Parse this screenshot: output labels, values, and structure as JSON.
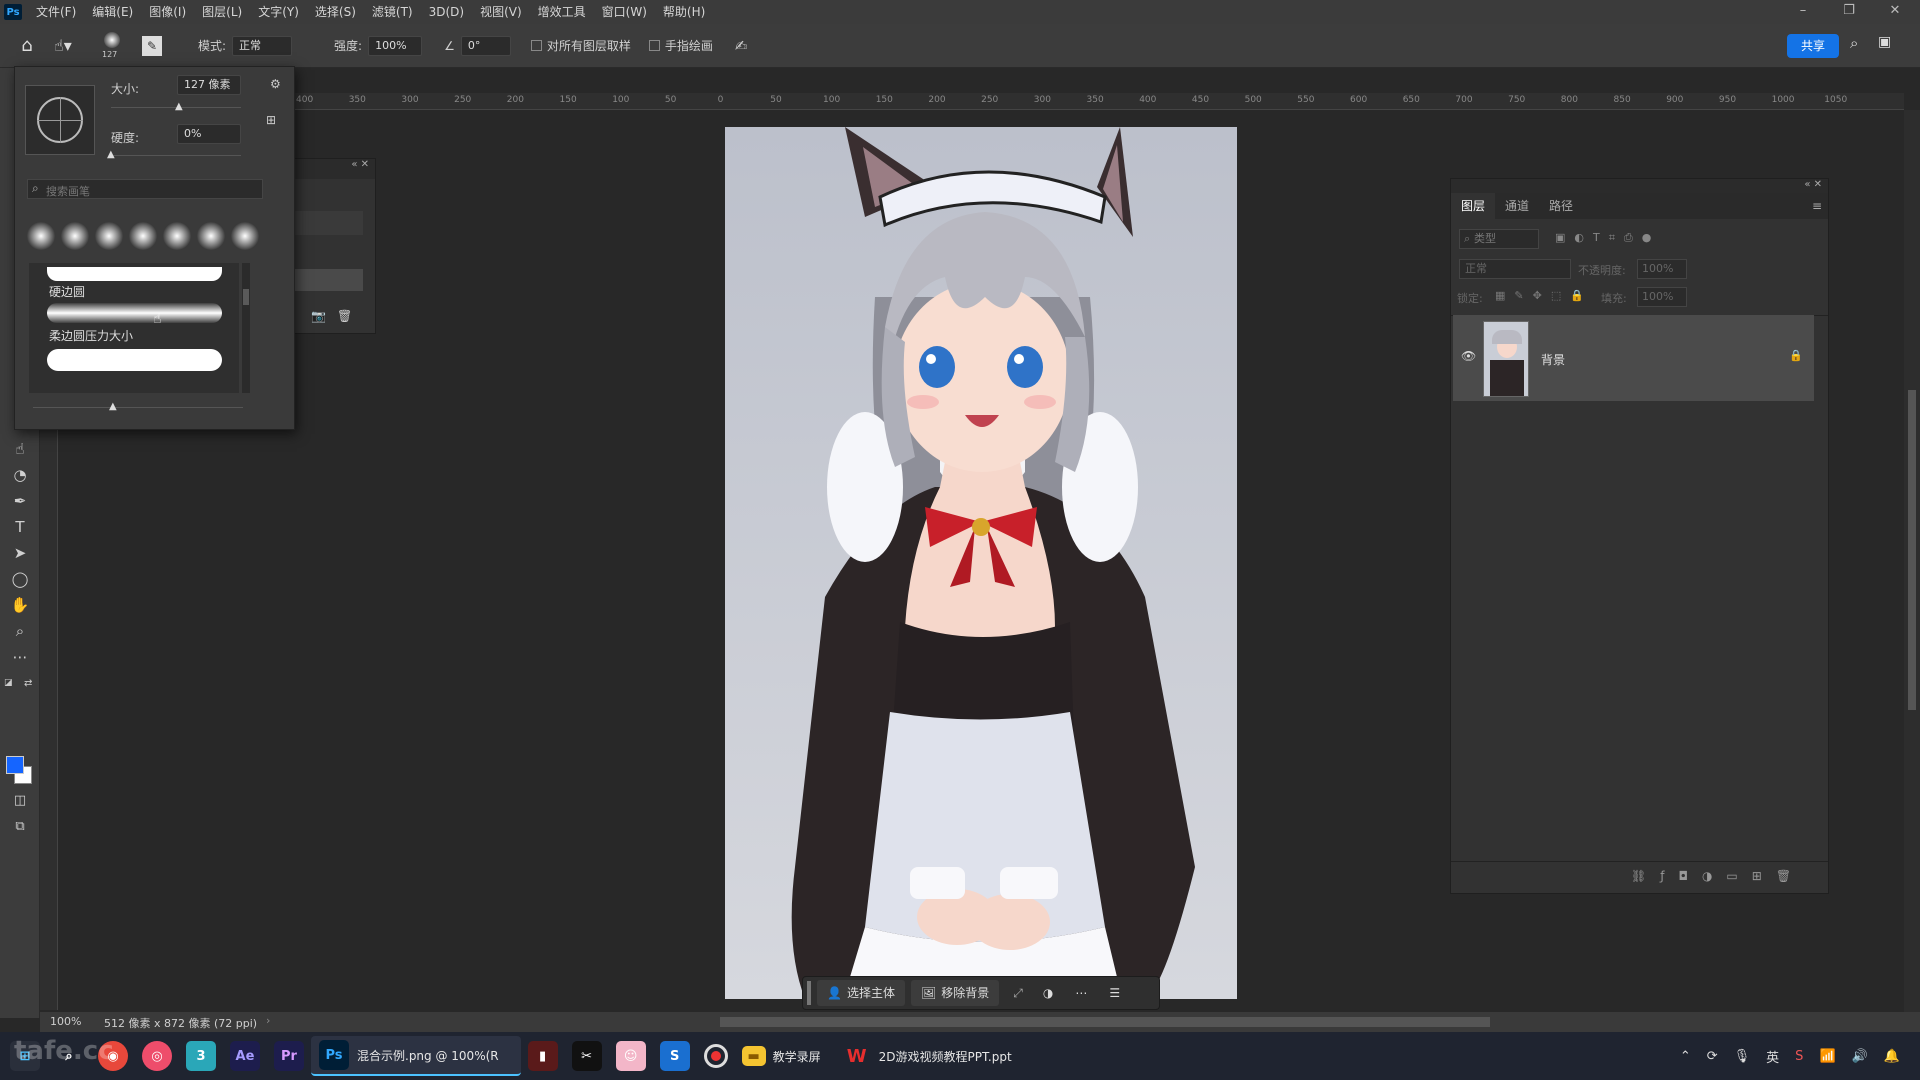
{
  "menubar": {
    "logo": "Ps",
    "items": [
      "文件(F)",
      "编辑(E)",
      "图像(I)",
      "图层(L)",
      "文字(Y)",
      "选择(S)",
      "滤镜(T)",
      "3D(D)",
      "视图(V)",
      "增效工具",
      "窗口(W)",
      "帮助(H)"
    ]
  },
  "options": {
    "brush_size_badge": "127",
    "mode_label": "模式:",
    "mode_value": "正常",
    "strength_label": "强度:",
    "strength_value": "100%",
    "angle_value": "0°",
    "sample_all_label": "对所有图层取样",
    "finger_paint_label": "手指绘画",
    "share_label": "共享"
  },
  "brush_popup": {
    "size_label": "大小:",
    "size_value": "127 像素",
    "hardness_label": "硬度:",
    "hardness_value": "0%",
    "search_placeholder": "搜索画笔",
    "presets": [
      {
        "name": "硬边圆"
      },
      {
        "name": "柔边圆压力大小"
      }
    ]
  },
  "ruler_ticks": [
    "400",
    "350",
    "300",
    "250",
    "200",
    "150",
    "100",
    "50",
    "0",
    "50",
    "100",
    "150",
    "200",
    "250",
    "300",
    "350",
    "400",
    "450",
    "500",
    "550",
    "600",
    "650",
    "700",
    "750",
    "800",
    "850",
    "900",
    "950",
    "1000",
    "1050"
  ],
  "layers_panel": {
    "tabs": [
      "图层",
      "通道",
      "路径"
    ],
    "filter_placeholder": "类型",
    "blend_mode": "正常",
    "opacity_label": "不透明度:",
    "opacity_value": "100%",
    "lock_label": "锁定:",
    "fill_label": "填充:",
    "fill_value": "100%",
    "layers": [
      {
        "name": "背景",
        "visible": true,
        "locked": true
      }
    ]
  },
  "contextual_bar": {
    "select_subject": "选择主体",
    "remove_bg": "移除背景"
  },
  "status": {
    "zoom": "100%",
    "doc_info": "512 像素 x 872 像素 (72 ppi)"
  },
  "taskbar": {
    "ps_window": "混合示例.png @ 100%(R",
    "folder_label": "教学录屏",
    "wps_label": "2D游戏视频教程PPT.ppt",
    "ime": "英",
    "watermark": "tafe.cc"
  },
  "colors": {
    "accent": "#1473e6",
    "foreground": "#1565ff",
    "background": "#ffffff"
  }
}
